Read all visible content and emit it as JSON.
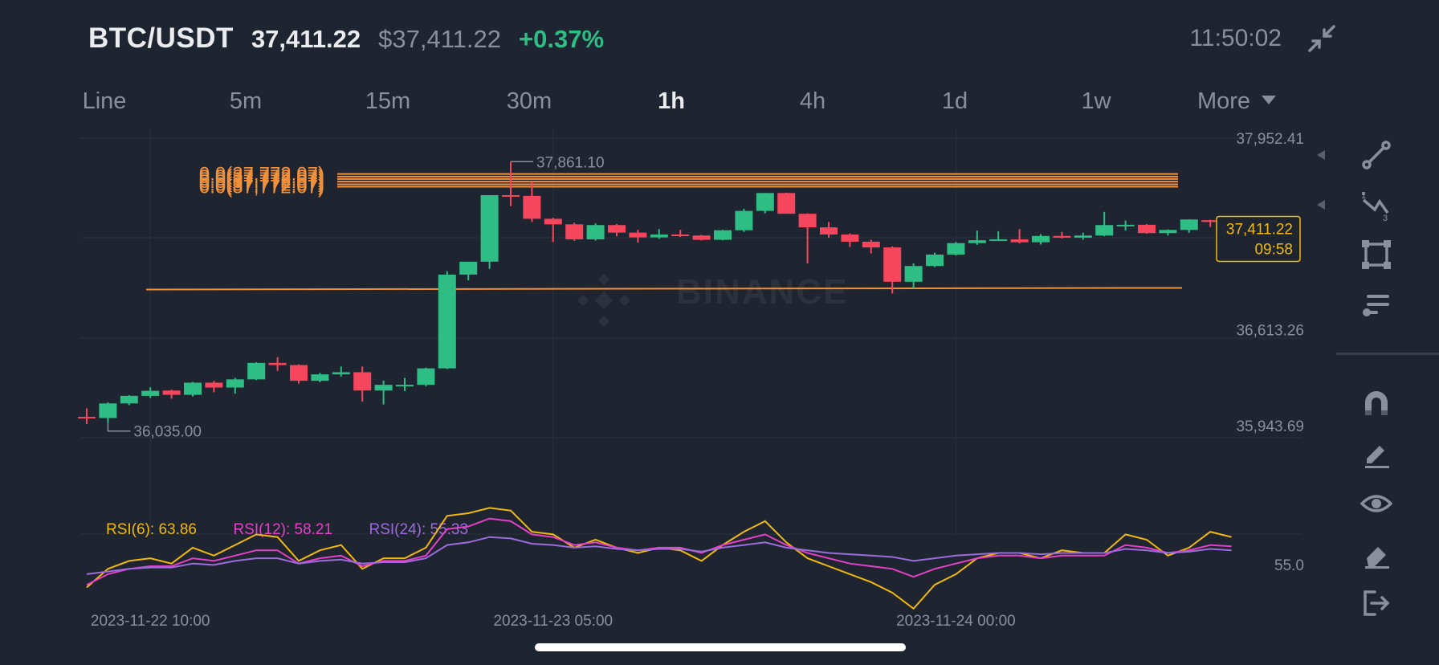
{
  "header": {
    "pair": "BTC/USDT",
    "last_price": "37,411.22",
    "usd_price": "$37,411.22",
    "change": "+0.37%",
    "time": "11:50:02"
  },
  "tabs": [
    {
      "label": "Line",
      "active": false
    },
    {
      "label": "5m",
      "active": false
    },
    {
      "label": "15m",
      "active": false
    },
    {
      "label": "30m",
      "active": false
    },
    {
      "label": "1h",
      "active": true
    },
    {
      "label": "4h",
      "active": false
    },
    {
      "label": "1d",
      "active": false
    },
    {
      "label": "1w",
      "active": false
    },
    {
      "label": "More",
      "active": false
    }
  ],
  "chart_data": {
    "type": "candlestick",
    "watermark": "BINANCE",
    "price_axis": {
      "ticks": [
        {
          "value": 37952.41,
          "label": "37,952.41"
        },
        {
          "value": 36613.26,
          "label": "36,613.26"
        },
        {
          "value": 35943.69,
          "label": "35,943.69"
        }
      ]
    },
    "time_axis": {
      "ticks": [
        {
          "index": 3,
          "label": "2023-11-22 10:00"
        },
        {
          "index": 22,
          "label": "2023-11-23 05:00"
        },
        {
          "index": 41,
          "label": "2023-11-24 00:00"
        }
      ]
    },
    "high_marker": {
      "index": 20,
      "label": "37,861.10"
    },
    "low_marker": {
      "index": 1,
      "label": "36,035.00"
    },
    "current_price": {
      "value": 37411.22,
      "label": "37,411.22",
      "countdown": "09:58"
    },
    "fib_levels": [
      37775,
      37757,
      37740,
      37722,
      37703,
      37686
    ],
    "fib_label": "0.0(37,772.07)",
    "horizontal_line": 36968,
    "candles": [
      {
        "o": 36078,
        "h": 36138,
        "l": 36028,
        "c": 36070
      },
      {
        "o": 36070,
        "h": 36180,
        "l": 36035,
        "c": 36172
      },
      {
        "o": 36172,
        "h": 36230,
        "l": 36160,
        "c": 36225
      },
      {
        "o": 36225,
        "h": 36285,
        "l": 36210,
        "c": 36260
      },
      {
        "o": 36262,
        "h": 36268,
        "l": 36205,
        "c": 36232
      },
      {
        "o": 36232,
        "h": 36322,
        "l": 36220,
        "c": 36317
      },
      {
        "o": 36317,
        "h": 36330,
        "l": 36250,
        "c": 36283
      },
      {
        "o": 36283,
        "h": 36350,
        "l": 36240,
        "c": 36340
      },
      {
        "o": 36340,
        "h": 36460,
        "l": 36335,
        "c": 36455
      },
      {
        "o": 36455,
        "h": 36495,
        "l": 36400,
        "c": 36440
      },
      {
        "o": 36440,
        "h": 36445,
        "l": 36310,
        "c": 36330
      },
      {
        "o": 36330,
        "h": 36385,
        "l": 36320,
        "c": 36375
      },
      {
        "o": 36375,
        "h": 36430,
        "l": 36360,
        "c": 36390
      },
      {
        "o": 36390,
        "h": 36430,
        "l": 36185,
        "c": 36262
      },
      {
        "o": 36262,
        "h": 36332,
        "l": 36165,
        "c": 36302
      },
      {
        "o": 36302,
        "h": 36350,
        "l": 36258,
        "c": 36302
      },
      {
        "o": 36302,
        "h": 36422,
        "l": 36292,
        "c": 36417
      },
      {
        "o": 36417,
        "h": 37095,
        "l": 36412,
        "c": 37072
      },
      {
        "o": 37072,
        "h": 37145,
        "l": 37032,
        "c": 37162
      },
      {
        "o": 37162,
        "h": 37627,
        "l": 37112,
        "c": 37627
      },
      {
        "o": 37627,
        "h": 37861,
        "l": 37550,
        "c": 37622
      },
      {
        "o": 37622,
        "h": 37720,
        "l": 37440,
        "c": 37462
      },
      {
        "o": 37462,
        "h": 37470,
        "l": 37300,
        "c": 37423
      },
      {
        "o": 37423,
        "h": 37435,
        "l": 37308,
        "c": 37318
      },
      {
        "o": 37318,
        "h": 37430,
        "l": 37310,
        "c": 37418
      },
      {
        "o": 37418,
        "h": 37425,
        "l": 37340,
        "c": 37365
      },
      {
        "o": 37365,
        "h": 37385,
        "l": 37296,
        "c": 37332
      },
      {
        "o": 37332,
        "h": 37390,
        "l": 37322,
        "c": 37352
      },
      {
        "o": 37352,
        "h": 37385,
        "l": 37335,
        "c": 37345
      },
      {
        "o": 37345,
        "h": 37350,
        "l": 37310,
        "c": 37315
      },
      {
        "o": 37315,
        "h": 37385,
        "l": 37312,
        "c": 37382
      },
      {
        "o": 37382,
        "h": 37532,
        "l": 37370,
        "c": 37517
      },
      {
        "o": 37517,
        "h": 37642,
        "l": 37500,
        "c": 37642
      },
      {
        "o": 37642,
        "h": 37645,
        "l": 37510,
        "c": 37497
      },
      {
        "o": 37497,
        "h": 37500,
        "l": 37150,
        "c": 37402
      },
      {
        "o": 37402,
        "h": 37440,
        "l": 37330,
        "c": 37352
      },
      {
        "o": 37352,
        "h": 37360,
        "l": 37265,
        "c": 37302
      },
      {
        "o": 37302,
        "h": 37315,
        "l": 37220,
        "c": 37262
      },
      {
        "o": 37262,
        "h": 37270,
        "l": 36940,
        "c": 37022
      },
      {
        "o": 37022,
        "h": 37150,
        "l": 36975,
        "c": 37132
      },
      {
        "o": 37132,
        "h": 37225,
        "l": 37125,
        "c": 37212
      },
      {
        "o": 37212,
        "h": 37300,
        "l": 37205,
        "c": 37292
      },
      {
        "o": 37292,
        "h": 37380,
        "l": 37280,
        "c": 37312
      },
      {
        "o": 37312,
        "h": 37375,
        "l": 37308,
        "c": 37318
      },
      {
        "o": 37318,
        "h": 37390,
        "l": 37290,
        "c": 37298
      },
      {
        "o": 37298,
        "h": 37355,
        "l": 37282,
        "c": 37342
      },
      {
        "o": 37342,
        "h": 37370,
        "l": 37325,
        "c": 37330
      },
      {
        "o": 37330,
        "h": 37365,
        "l": 37315,
        "c": 37345
      },
      {
        "o": 37345,
        "h": 37510,
        "l": 37340,
        "c": 37418
      },
      {
        "o": 37418,
        "h": 37450,
        "l": 37380,
        "c": 37420
      },
      {
        "o": 37420,
        "h": 37425,
        "l": 37358,
        "c": 37362
      },
      {
        "o": 37362,
        "h": 37388,
        "l": 37345,
        "c": 37384
      },
      {
        "o": 37384,
        "h": 37458,
        "l": 37364,
        "c": 37457
      },
      {
        "o": 37452,
        "h": 37455,
        "l": 37405,
        "c": 37440
      }
    ],
    "rsi": {
      "legend": [
        {
          "label": "RSI(6): 63.86",
          "color": "#f0b90b"
        },
        {
          "label": "RSI(12): 58.21",
          "color": "#e440c8"
        },
        {
          "label": "RSI(24): 55.33",
          "color": "#9b6cdc"
        }
      ],
      "axis_label": "55.0",
      "series": [
        {
          "color": "#f0b90b",
          "values": [
            42,
            49,
            52,
            53,
            51,
            57,
            54,
            58,
            62,
            61,
            52,
            56,
            58,
            49,
            53,
            53,
            57,
            69,
            70,
            72,
            71,
            63,
            62,
            57,
            60,
            57,
            55,
            57,
            56,
            52,
            58,
            63,
            67,
            59,
            53,
            50,
            47,
            44,
            40,
            34,
            43,
            47,
            53,
            55,
            55,
            53,
            56,
            55,
            55,
            62,
            60,
            54,
            57,
            63,
            61
          ]
        },
        {
          "color": "#e440c8",
          "values": [
            43,
            47,
            49,
            50,
            50,
            53,
            52,
            54,
            56,
            56,
            51,
            53,
            54,
            50,
            52,
            52,
            54,
            64,
            65,
            68,
            67,
            62,
            61,
            58,
            59,
            57,
            56,
            57,
            57,
            55,
            58,
            60,
            62,
            58,
            55,
            53,
            51,
            50,
            49,
            46,
            49,
            51,
            53,
            54,
            54,
            53,
            54,
            54,
            54,
            58,
            57,
            55,
            56,
            58,
            57.5
          ]
        },
        {
          "color": "#9b6cdc",
          "values": [
            47,
            48,
            49,
            49.5,
            49.5,
            51,
            50.5,
            52,
            53,
            53,
            51,
            52,
            52.5,
            51,
            51.5,
            51.5,
            53,
            58,
            59,
            61,
            60.5,
            58.5,
            58,
            57,
            57.5,
            56.5,
            56,
            56.5,
            56.5,
            55.5,
            57,
            58,
            59,
            57,
            56,
            55,
            54.5,
            54,
            53.5,
            52,
            53,
            54,
            54.5,
            55,
            55,
            54.5,
            55,
            55,
            55,
            56.5,
            56,
            55,
            55.5,
            56.5,
            56
          ]
        }
      ]
    }
  }
}
